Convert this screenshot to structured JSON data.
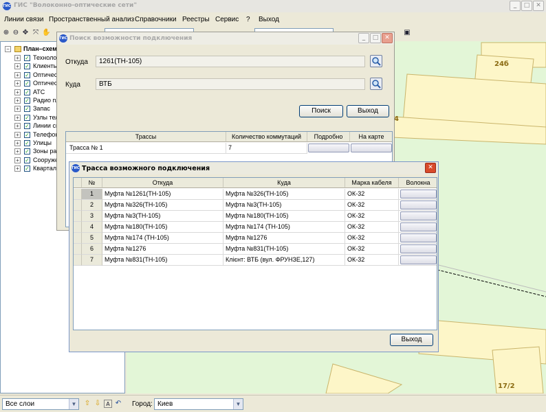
{
  "app": {
    "title": "ГИС \"Волоконно-оптические сети\""
  },
  "menu": [
    "Линии связи",
    "Пространственный анализ",
    "Справочники",
    "Реестры",
    "Сервис",
    "?",
    "Выход"
  ],
  "tree": {
    "root": "План–схем",
    "items": [
      "Техноло",
      "Клиенть",
      "Оптичес",
      "Оптичес",
      "АТС",
      "Радио пл",
      "Запас",
      "Узлы тел",
      "Линии св",
      "Телефон",
      "Улицы",
      "Зоны рад",
      "Сооруже",
      "Квартал"
    ]
  },
  "map": {
    "labels": [
      "24б",
      "4",
      "17/2"
    ]
  },
  "status": {
    "layers_value": "Все слои",
    "city_label": "Город:",
    "city_value": "Киев"
  },
  "search_dialog": {
    "title": "Поиск возможности подключения",
    "from_label": "Откуда",
    "from_value": "1261(ТН-105)",
    "to_label": "Куда",
    "to_value": "ВТБ",
    "search_button": "Поиск",
    "exit_button": "Выход",
    "columns": [
      "Трассы",
      "Количество коммутаций",
      "Подробно",
      "На карте"
    ],
    "rows": [
      {
        "route": "Трасса № 1",
        "count": "7"
      }
    ]
  },
  "route_dialog": {
    "title": "Трасса возможного подключения",
    "columns": [
      "№",
      "Откуда",
      "Куда",
      "Марка кабеля",
      "Волокна"
    ],
    "rows": [
      {
        "n": "1",
        "from": "Муфта №1261(ТН-105)",
        "to": "Муфта №326(ТН-105)",
        "cable": "ОК-32"
      },
      {
        "n": "2",
        "from": "Муфта №326(ТН-105)",
        "to": "Муфта №3(ТН-105)",
        "cable": "ОК-32"
      },
      {
        "n": "3",
        "from": "Муфта №3(ТН-105)",
        "to": "Муфта №180(ТН-105)",
        "cable": "ОК-32"
      },
      {
        "n": "4",
        "from": "Муфта №180(ТН-105)",
        "to": "Муфта №174 (ТН-105)",
        "cable": "ОК-32"
      },
      {
        "n": "5",
        "from": "Муфта №174 (ТН-105)",
        "to": "Муфта №1276",
        "cable": "ОК-32"
      },
      {
        "n": "6",
        "from": "Муфта №1276",
        "to": "Муфта №831(ТН-105)",
        "cable": "ОК-32"
      },
      {
        "n": "7",
        "from": "Муфта №831(ТН-105)",
        "to": "Клієнт: ВТБ (вул. ФРУНЗЕ,127)",
        "cable": "ОК-32"
      }
    ],
    "exit_button": "Выход"
  },
  "colors": {
    "map_background": "#e3f6d7",
    "building_fill": "#fdf6c8",
    "close_button": "#d84a2a"
  }
}
